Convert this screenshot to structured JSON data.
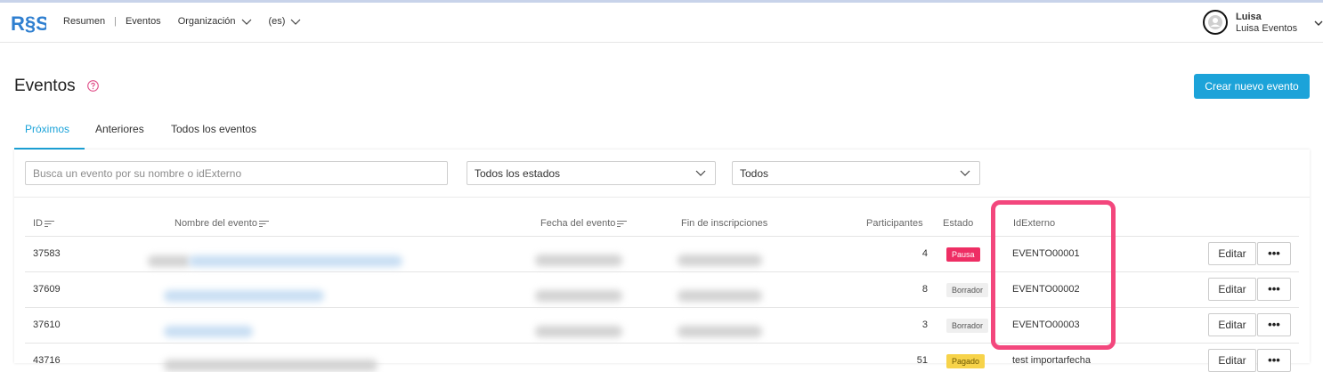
{
  "brand": {
    "logo_text": "R§S",
    "logo_color": "#2f7fd0"
  },
  "nav": {
    "items": [
      {
        "label": "Resumen"
      },
      {
        "label": "Eventos"
      },
      {
        "label": "Organización"
      },
      {
        "label": "(es)"
      }
    ],
    "separator": "|"
  },
  "user": {
    "name": "Luisa",
    "org": "Luisa Eventos"
  },
  "page": {
    "title": "Eventos",
    "create_button": "Crear nuevo evento"
  },
  "tabs": [
    {
      "label": "Próximos",
      "active": true
    },
    {
      "label": "Anteriores",
      "active": false
    },
    {
      "label": "Todos los eventos",
      "active": false
    }
  ],
  "filters": {
    "search_placeholder": "Busca un evento por su nombre o idExterno",
    "status_select": "Todos los estados",
    "type_select": "Todos"
  },
  "table": {
    "headers": {
      "id": "ID",
      "name": "Nombre del evento",
      "date": "Fecha del evento",
      "end": "Fin de inscripciones",
      "participants": "Participantes",
      "status": "Estado",
      "external_id": "IdExterno"
    },
    "rows": [
      {
        "id": "37583",
        "participants": "4",
        "status": "Pausa",
        "external_id": "EVENTO00001",
        "edit": "Editar",
        "more": "•••"
      },
      {
        "id": "37609",
        "participants": "8",
        "status": "Borrador",
        "external_id": "EVENTO00002",
        "edit": "Editar",
        "more": "•••"
      },
      {
        "id": "37610",
        "participants": "3",
        "status": "Borrador",
        "external_id": "EVENTO00003",
        "edit": "Editar",
        "more": "•••"
      },
      {
        "id": "43716",
        "participants": "51",
        "status": "Pagado",
        "external_id": "test importarfecha",
        "edit": "Editar",
        "more": "•••"
      }
    ]
  },
  "colors": {
    "accent": "#1ca3d9",
    "status_pausa": "#ee2e64",
    "status_borrador": "#efefef",
    "status_pagado": "#f7d34a",
    "highlight": "#f3477d"
  }
}
